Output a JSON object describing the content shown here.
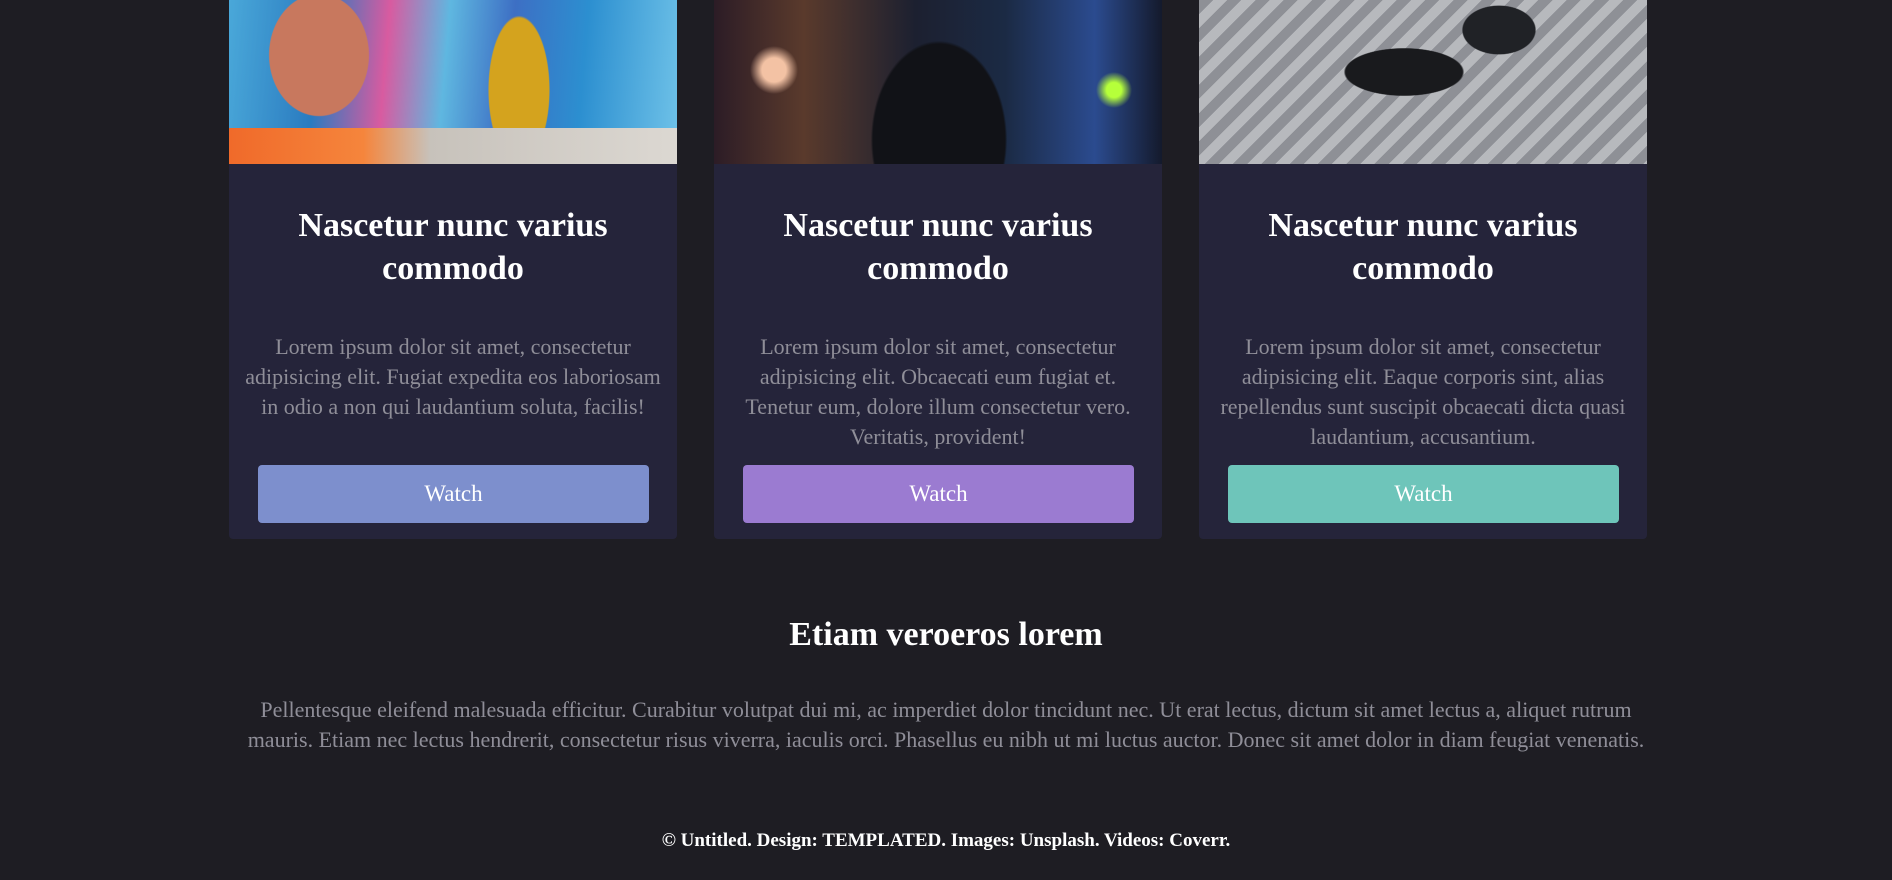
{
  "cards": [
    {
      "image": "street-art-woman-photo",
      "title": "Nascetur nunc varius commodo",
      "text": "Lorem ipsum dolor sit amet, consectetur adipisicing elit. Fugiat expedita eos laboriosam in odio a non qui laudantium soluta, facilis!",
      "button_label": "Watch",
      "button_color": "#7d8fcd"
    },
    {
      "image": "city-night-hoodie-photo",
      "title": "Nascetur nunc varius commodo",
      "text": "Lorem ipsum dolor sit amet, consectetur adipisicing elit. Obcaecati eum fugiat et. Tenetur eum, dolore illum consectetur vero. Veritatis, provident!",
      "button_label": "Watch",
      "button_color": "#9b7bd1"
    },
    {
      "image": "sneakers-fire-escape-photo",
      "title": "Nascetur nunc varius commodo",
      "text": "Lorem ipsum dolor sit amet, consectetur adipisicing elit. Eaque corporis sint, alias repellendus sunt suscipit obcaecati dicta quasi laudantium, accusantium.",
      "button_label": "Watch",
      "button_color": "#6ec5ba"
    }
  ],
  "section": {
    "title": "Etiam veroeros lorem",
    "text": "Pellentesque eleifend malesuada efficitur. Curabitur volutpat dui mi, ac imperdiet dolor tincidunt nec. Ut erat lectus, dictum sit amet lectus a, aliquet rutrum mauris. Etiam nec lectus hendrerit, consectetur risus viverra, iaculis orci. Phasellus eu nibh ut mi luctus auctor. Donec sit amet dolor in diam feugiat venenatis."
  },
  "footer": {
    "text": "© Untitled. Design: TEMPLATED. Images: Unsplash. Videos: Coverr."
  },
  "colors": {
    "background": "#1e1d23",
    "card_background": "#25243a",
    "heading": "#ffffff",
    "body_text": "#8f8e98"
  }
}
